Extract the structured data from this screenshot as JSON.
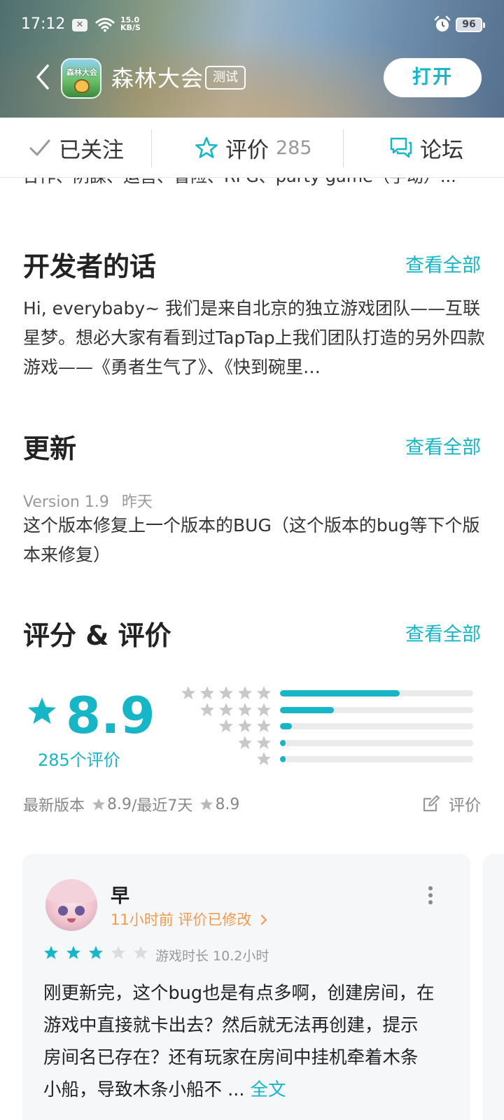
{
  "status_bar": {
    "time": "17:12",
    "net_speed_value": "15.0",
    "net_speed_unit": "KB/S",
    "battery": "96"
  },
  "header": {
    "app_title": "森林大会",
    "badge": "测试",
    "open_button": "打开",
    "icon_label": "森林大会"
  },
  "action_bar": {
    "follow_label": "已关注",
    "rate_label": "评价",
    "rate_count": "285",
    "forum_label": "论坛"
  },
  "peek_text": "合作、阴謀、运营、冒险、RPG、party game（手动）...",
  "developer": {
    "title": "开发者的话",
    "see_all": "查看全部",
    "text": "Hi, everybaby~ 我们是来自北京的独立游戏团队——互联星梦。想必大家有看到过TapTap上我们团队打造的另外四款游戏——《勇者生气了》、《快到碗里…"
  },
  "update": {
    "title": "更新",
    "see_all": "查看全部",
    "version": "Version 1.9",
    "date": "昨天",
    "text": "这个版本修复上一个版本的BUG（这个版本的bug等下个版本来修复）"
  },
  "ratings": {
    "title": "评分 & 评价",
    "see_all": "查看全部",
    "score": "8.9",
    "count_label": "285个评价",
    "distribution": [
      {
        "stars": 5,
        "fraction": 0.62
      },
      {
        "stars": 4,
        "fraction": 0.28
      },
      {
        "stars": 3,
        "fraction": 0.06
      },
      {
        "stars": 2,
        "fraction": 0.03
      },
      {
        "stars": 1,
        "fraction": 0.03
      }
    ],
    "latest_version_label": "最新版本",
    "latest_version_score": "8.9",
    "recent_label": "/最近7天",
    "recent_score": "8.9",
    "write_review": "评价",
    "accent_color": "#16b6c6"
  },
  "review": {
    "name": "早",
    "time_status": "11小时前 评价已修改",
    "stars": 3,
    "max_stars": 5,
    "playtime": "游戏时长 10.2小时",
    "text": "刚更新完，这个bug也是有点多啊，创建房间，在游戏中直接就卡出去？然后就无法再创建，提示房间名已存在？还有玩家在房间中挂机牵着木条小船，导致木条小船不 ... ",
    "full_text_link": "全文"
  }
}
